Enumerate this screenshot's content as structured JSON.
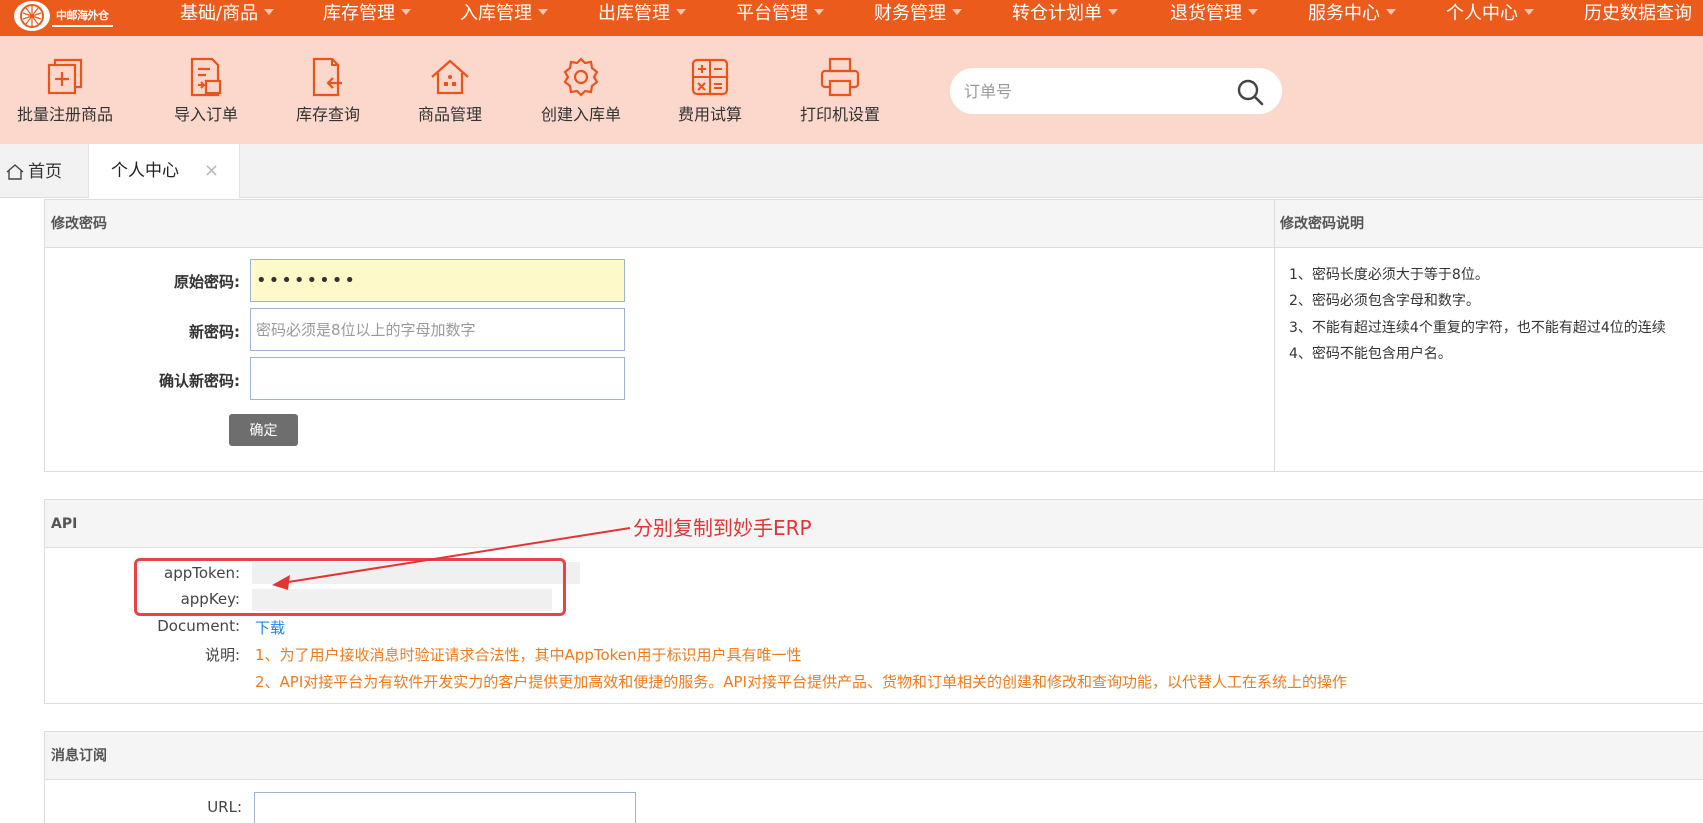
{
  "logo": {
    "text": "中邮海外仓"
  },
  "nav": {
    "items": [
      {
        "label": "基础/商品"
      },
      {
        "label": "库存管理"
      },
      {
        "label": "入库管理"
      },
      {
        "label": "出库管理"
      },
      {
        "label": "平台管理"
      },
      {
        "label": "财务管理"
      },
      {
        "label": "转仓计划单"
      },
      {
        "label": "退货管理"
      },
      {
        "label": "服务中心"
      },
      {
        "label": "个人中心"
      },
      {
        "label": "历史数据查询"
      }
    ]
  },
  "toolbar": {
    "items": [
      {
        "label": "批量注册商品",
        "icon": "batch-register-icon"
      },
      {
        "label": "导入订单",
        "icon": "import-order-icon"
      },
      {
        "label": "库存查询",
        "icon": "inventory-query-icon"
      },
      {
        "label": "商品管理",
        "icon": "product-manage-icon"
      },
      {
        "label": "创建入库单",
        "icon": "gear-icon"
      },
      {
        "label": "费用试算",
        "icon": "calculator-icon"
      },
      {
        "label": "打印机设置",
        "icon": "printer-icon"
      }
    ],
    "search_placeholder": "订单号",
    "search_value": ""
  },
  "tabs": {
    "home_label": "首页",
    "active_label": "个人中心",
    "close_glyph": "×"
  },
  "password": {
    "title": "修改密码",
    "note_title": "修改密码说明",
    "old_label": "原始密码:",
    "old_value": "••••••••",
    "new_label": "新密码:",
    "new_placeholder": "密码必须是8位以上的字母加数字",
    "confirm_label": "确认新密码:",
    "confirm_value": "",
    "submit_label": "确定",
    "notes": [
      "1、密码长度必须大于等于8位。",
      "2、密码必须包含字母和数字。",
      "3、不能有超过连续4个重复的字符，也不能有超过4位的连续",
      "4、密码不能包含用户名。"
    ]
  },
  "api": {
    "title": "API",
    "token_label": "appToken:",
    "key_label": "appKey:",
    "document_label": "Document:",
    "download_label": "下载",
    "desc_label": "说明:",
    "desc_lines": [
      "1、为了用户接收消息时验证请求合法性，其中AppToken用于标识用户具有唯一性",
      "2、API对接平台为有软件开发实力的客户提供更加高效和便捷的服务。API对接平台提供产品、货物和订单相关的创建和修改和查询功能，以代替人工在系统上的操作"
    ],
    "annotation": "分别复制到妙手ERP"
  },
  "subscribe": {
    "title": "消息订阅",
    "url_label": "URL:",
    "url_value": ""
  },
  "colors": {
    "nav_bg": "#ea5b1c",
    "toolbar_bg": "#fbd8cb",
    "annotation_red": "#e23535",
    "desc_orange": "#ee7b1e",
    "link_blue": "#1e88e5"
  }
}
